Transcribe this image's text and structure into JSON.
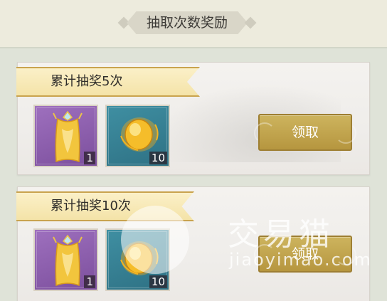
{
  "header": {
    "title": "抽取次数奖励"
  },
  "rewards": [
    {
      "label": "累计抽奖5次",
      "items": [
        {
          "icon": "golden-cape-icon",
          "count": "1"
        },
        {
          "icon": "gold-orb-icon",
          "count": "10"
        }
      ],
      "button_label": "领取"
    },
    {
      "label": "累计抽奖10次",
      "items": [
        {
          "icon": "golden-cape-icon",
          "count": "1"
        },
        {
          "icon": "gold-orb-icon",
          "count": "10"
        }
      ],
      "button_label": "领取"
    }
  ],
  "watermark": {
    "brand": "交易猫",
    "url": "jiaoyimao.com"
  },
  "colors": {
    "ribbon": "#f4e3a8",
    "button": "#b6963f",
    "purple_slot": "#7c4f9d",
    "teal_slot": "#2e7184"
  }
}
